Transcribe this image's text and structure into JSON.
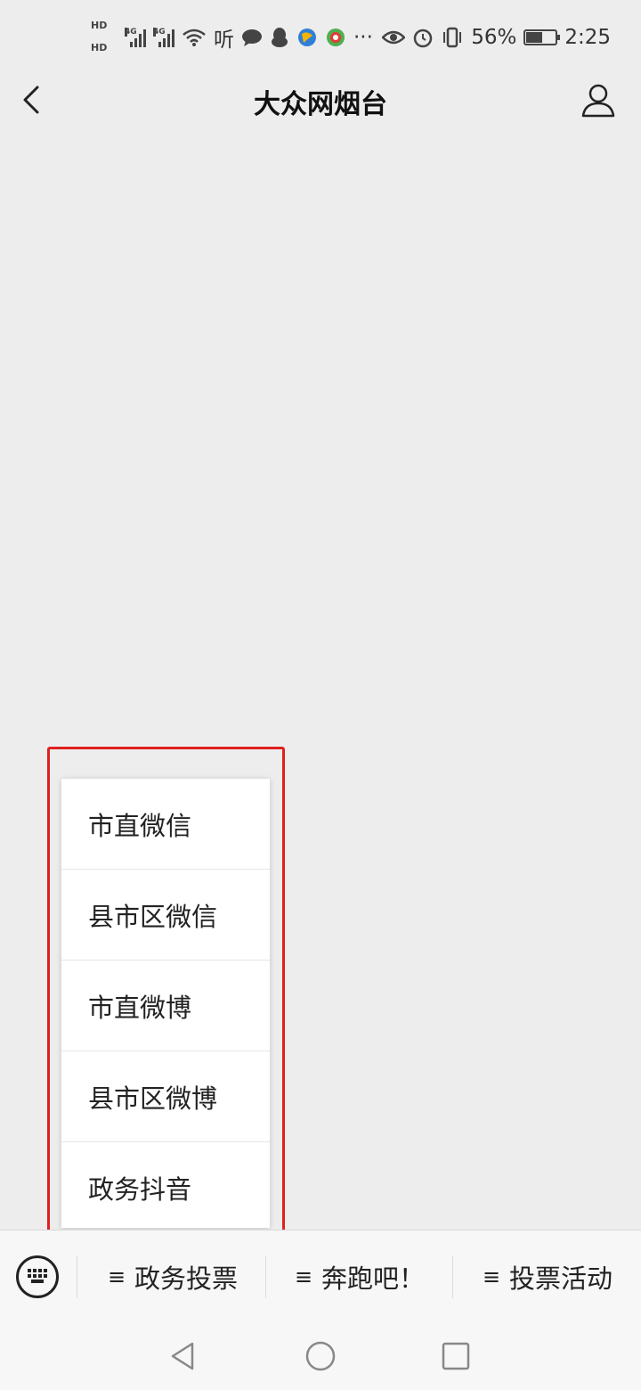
{
  "status_bar": {
    "hd1": "HD",
    "hd2": "HD",
    "sig_label_1": "4G",
    "sig_label_2": "4G",
    "listen_icon_text": "听",
    "more_text": "···",
    "battery_percent": "56%",
    "battery_level": 0.56,
    "time": "2:25"
  },
  "header": {
    "title": "大众网烟台"
  },
  "submenu": {
    "items": [
      "市直微信",
      "县市区微信",
      "市直微博",
      "县市区微博",
      "政务抖音"
    ]
  },
  "menu_bar": {
    "icon_glyph": "≡",
    "buttons": [
      "政务投票",
      "奔跑吧！",
      "投票活动"
    ]
  },
  "colors": {
    "background": "#ededed",
    "highlight": "#e02020",
    "menu_bar": "#f7f7f7"
  },
  "icons": [
    "back-icon",
    "profile-icon",
    "keyboard-icon",
    "nav-back-icon",
    "nav-home-icon",
    "nav-recent-icon"
  ]
}
